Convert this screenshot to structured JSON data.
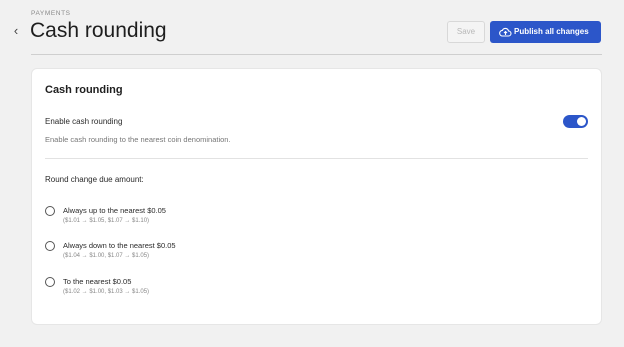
{
  "header": {
    "breadcrumb": "PAYMENTS",
    "title": "Cash rounding",
    "back_icon": "chevron-left-icon",
    "save_label": "Save",
    "publish_label": "Publish all changes",
    "publish_icon": "cloud-upload-icon"
  },
  "card": {
    "title": "Cash rounding",
    "toggle_label": "Enable cash rounding",
    "toggle_help": "Enable cash rounding to the nearest coin denomination.",
    "toggle_on": true,
    "section_label": "Round change due amount:",
    "options": [
      {
        "label": "Always up to the nearest $0.05",
        "example": "($1.01 → $1.05, $1.07 → $1.10)",
        "selected": false
      },
      {
        "label": "Always down to the nearest $0.05",
        "example": "($1.04 → $1.00, $1.07 → $1.05)",
        "selected": false
      },
      {
        "label": "To the nearest $0.05",
        "example": "($1.02 → $1.00, $1.03 → $1.05)",
        "selected": false
      }
    ]
  },
  "colors": {
    "accent": "#2c56c9",
    "background": "#f1f1f1"
  }
}
